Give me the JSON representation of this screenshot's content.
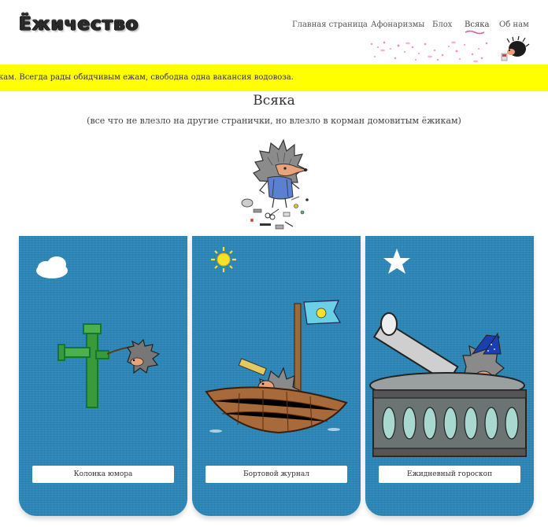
{
  "site": {
    "logo": "Ёжичество"
  },
  "nav": {
    "items": [
      {
        "label": "Главная страница"
      },
      {
        "label": "Афонаризмы"
      },
      {
        "label": "Блох"
      },
      {
        "label": "Всяка"
      },
      {
        "label": "Об нам"
      }
    ],
    "active_index": 3
  },
  "ticker": {
    "text": "кам. Всегда рады обидчивым ежам, свободна одна вакансия водовоза."
  },
  "page": {
    "title": "Всяка",
    "subtitle": "(все что не влезло на другие странички, но влезло в корман домовитым ёжикам)"
  },
  "cards": [
    {
      "button_label": "Колонка юмора",
      "icon": "cloud-icon"
    },
    {
      "button_label": "Бортовой журнал",
      "icon": "sun-icon"
    },
    {
      "button_label": "Ежидневный гороскоп",
      "icon": "star-icon"
    }
  ],
  "colors": {
    "ticker_bg": "#ffff00",
    "card_bg": "#2b86b6",
    "accent_underline": "#e05aa8"
  }
}
